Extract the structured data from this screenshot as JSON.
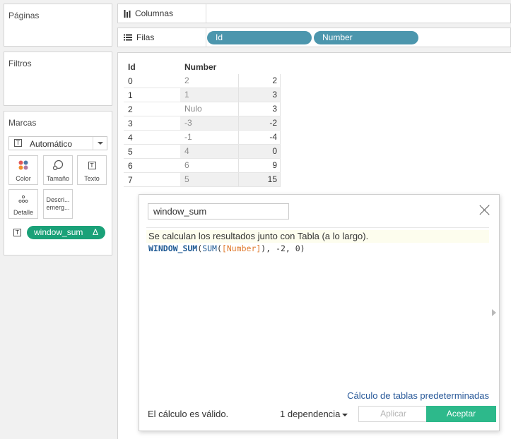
{
  "panes": {
    "pages_title": "Páginas",
    "filters_title": "Filtros",
    "marks_title": "Marcas"
  },
  "marks": {
    "type_selected": "Automático",
    "buttons": {
      "color": "Color",
      "size": "Tamaño",
      "text": "Texto",
      "detail": "Detalle",
      "tooltip_line1": "Descri...",
      "tooltip_line2": "emerg..."
    },
    "field_pill": "window_sum",
    "field_pill_delta": "Δ"
  },
  "shelves": {
    "columns_label": "Columnas",
    "rows_label": "Filas",
    "row_pills": [
      "Id",
      "Number"
    ]
  },
  "view_table": {
    "headers": [
      "Id",
      "Number"
    ],
    "rows": [
      {
        "id": "0",
        "number": "2",
        "window_sum": "2"
      },
      {
        "id": "1",
        "number": "1",
        "window_sum": "3"
      },
      {
        "id": "2",
        "number": "Nulo",
        "window_sum": "3"
      },
      {
        "id": "3",
        "number": "-3",
        "window_sum": "-2"
      },
      {
        "id": "4",
        "number": "-1",
        "window_sum": "-4"
      },
      {
        "id": "5",
        "number": "4",
        "window_sum": "0"
      },
      {
        "id": "6",
        "number": "6",
        "window_sum": "9"
      },
      {
        "id": "7",
        "number": "5",
        "window_sum": "15"
      }
    ]
  },
  "calc_dialog": {
    "name": "window_sum",
    "info_text": "Se calculan los resultados junto con Tabla (a lo largo).",
    "formula": {
      "fn": "WINDOW_SUM",
      "paren_open": "(",
      "agg": "SUM",
      "paren_open2": "(",
      "field": "[Number]",
      "rest": "), -2, 0)"
    },
    "default_table_calc_link": "Cálculo de tablas predeterminadas",
    "status": "El cálculo es válido.",
    "dependencies": "1 dependencia",
    "apply_button": "Aplicar",
    "ok_button": "Aceptar"
  }
}
